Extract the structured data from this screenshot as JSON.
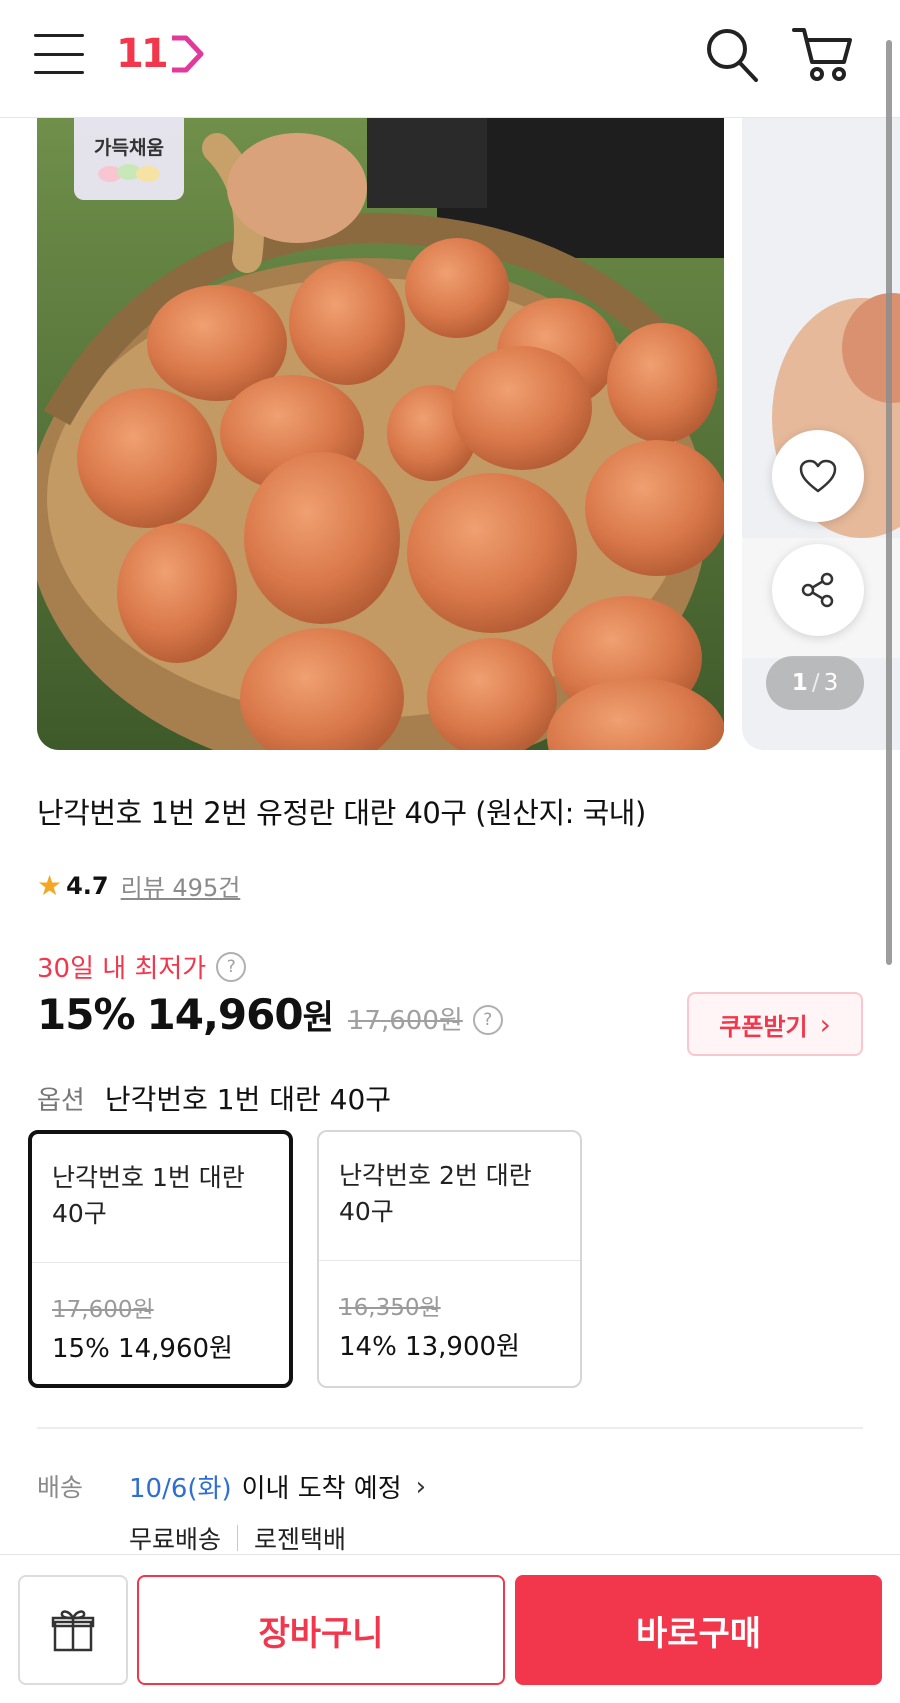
{
  "header": {
    "logo_text": "11",
    "icons": [
      "menu-icon",
      "search-icon",
      "cart-icon"
    ]
  },
  "gallery": {
    "badge_text": "가득채움",
    "current": "1",
    "separator": "/",
    "total": "3",
    "buttons": [
      "heart-icon",
      "share-icon"
    ]
  },
  "product": {
    "title": "난각번호 1번 2번 유정란 대란 40구 (원산지: 국내)",
    "rating": "4.7",
    "review_link": "리뷰 495건"
  },
  "price": {
    "lowest_label": "30일 내 최저가",
    "help_glyph": "?",
    "discount": "15%",
    "amount": "14,960",
    "currency": "원",
    "original": "17,600원",
    "coupon_label": "쿠폰받기",
    "coupon_chevron": "›"
  },
  "options": {
    "label": "옵션",
    "selected_value": "난각번호 1번 대란 40구",
    "cards": [
      {
        "name": "난각번호 1번 대란 40구",
        "was": "17,600원",
        "now": "15% 14,960원",
        "selected": true
      },
      {
        "name": "난각번호 2번 대란 40구",
        "was": "16,350원",
        "now": "14% 13,900원",
        "selected": false
      }
    ]
  },
  "delivery": {
    "label": "배송",
    "date": "10/6(화)",
    "eta_text": "이내 도착 예정",
    "chevron": "›",
    "shipping_fee": "무료배송",
    "carrier": "로젠택배"
  },
  "bottom_bar": {
    "cart_label": "장바구니",
    "buy_label": "바로구매"
  },
  "colors": {
    "brand": "#f2364b",
    "date_blue": "#2f6fd1",
    "star": "#f5a623"
  }
}
